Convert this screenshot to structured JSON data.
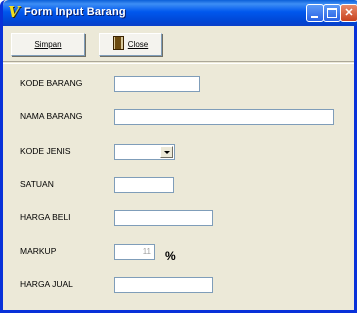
{
  "window": {
    "title": "Form Input Barang",
    "icon": "yellow-v-icon",
    "controls": {
      "minimize_icon": "minimize-icon",
      "maximize_icon": "maximize-icon",
      "close_icon": "close-icon",
      "close_glyph": "✕"
    }
  },
  "toolbar": {
    "simpan_label": "Simpan",
    "close_label": "Close",
    "close_icon": "door-icon"
  },
  "form": {
    "kode_barang": {
      "label": "KODE BARANG",
      "value": ""
    },
    "nama_barang": {
      "label": "NAMA BARANG",
      "value": ""
    },
    "kode_jenis": {
      "label": "KODE JENIS",
      "value": ""
    },
    "satuan": {
      "label": "SATUAN",
      "value": ""
    },
    "harga_beli": {
      "label": "HARGA BELI",
      "value": ""
    },
    "markup": {
      "label": "MARKUP",
      "value": "11",
      "unit": "%"
    },
    "harga_jual": {
      "label": "HARGA JUAL",
      "value": ""
    }
  },
  "colors": {
    "title_bar": "#0058ee",
    "window_bg": "#ece9d8",
    "field_border": "#7f9db9"
  }
}
